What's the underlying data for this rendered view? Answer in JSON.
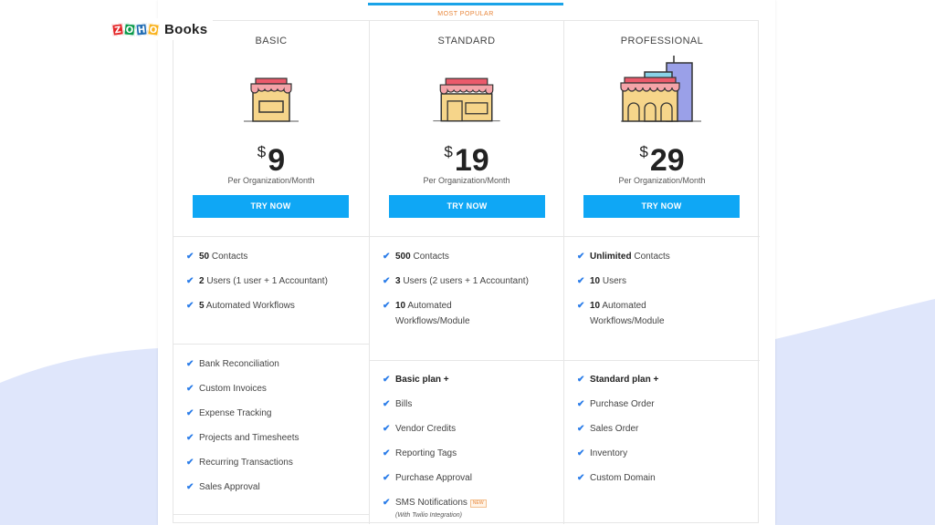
{
  "brand": {
    "logo_letters": [
      "Z",
      "O",
      "H",
      "O"
    ],
    "product": "Books"
  },
  "colors": {
    "accent": "#0fa7f5",
    "check": "#2b7de9",
    "popular": "#e8863a",
    "wave": "#dfe6fb"
  },
  "popular_label": "MOST POPULAR",
  "plans": [
    {
      "name": "BASIC",
      "currency": "$",
      "price": "9",
      "period": "Per Organization/Month",
      "cta": "TRY NOW",
      "limits": [
        {
          "bold": "50",
          "text": " Contacts"
        },
        {
          "bold": "2",
          "text": " Users (1 user + 1 Accountant)"
        },
        {
          "bold": "5",
          "text": " Automated Workflows"
        }
      ],
      "features": [
        "Bank Reconciliation",
        "Custom Invoices",
        "Expense Tracking",
        "Projects and Timesheets",
        "Recurring Transactions",
        "Sales Approval"
      ]
    },
    {
      "name": "STANDARD",
      "currency": "$",
      "price": "19",
      "period": "Per Organization/Month",
      "cta": "TRY NOW",
      "limits": [
        {
          "bold": "500",
          "text": " Contacts"
        },
        {
          "bold": "3",
          "text": " Users (2 users + 1 Accountant)"
        },
        {
          "bold": "10",
          "text": " Automated",
          "line2": "Workflows/Module"
        }
      ],
      "features_header": "Basic plan +",
      "features": [
        "Bills",
        "Vendor Credits",
        "Reporting Tags",
        "Purchase Approval",
        "SMS Notifications"
      ],
      "new_badge": "NEW",
      "sms_note": "(With Twilio Integration)"
    },
    {
      "name": "PROFESSIONAL",
      "currency": "$",
      "price": "29",
      "period": "Per Organization/Month",
      "cta": "TRY NOW",
      "limits": [
        {
          "bold": "Unlimited",
          "text": " Contacts"
        },
        {
          "bold": "10",
          "text": " Users"
        },
        {
          "bold": "10",
          "text": " Automated",
          "line2": "Workflows/Module"
        }
      ],
      "features_header": "Standard plan +",
      "features": [
        "Purchase Order",
        "Sales Order",
        "Inventory",
        "Custom Domain"
      ]
    }
  ]
}
